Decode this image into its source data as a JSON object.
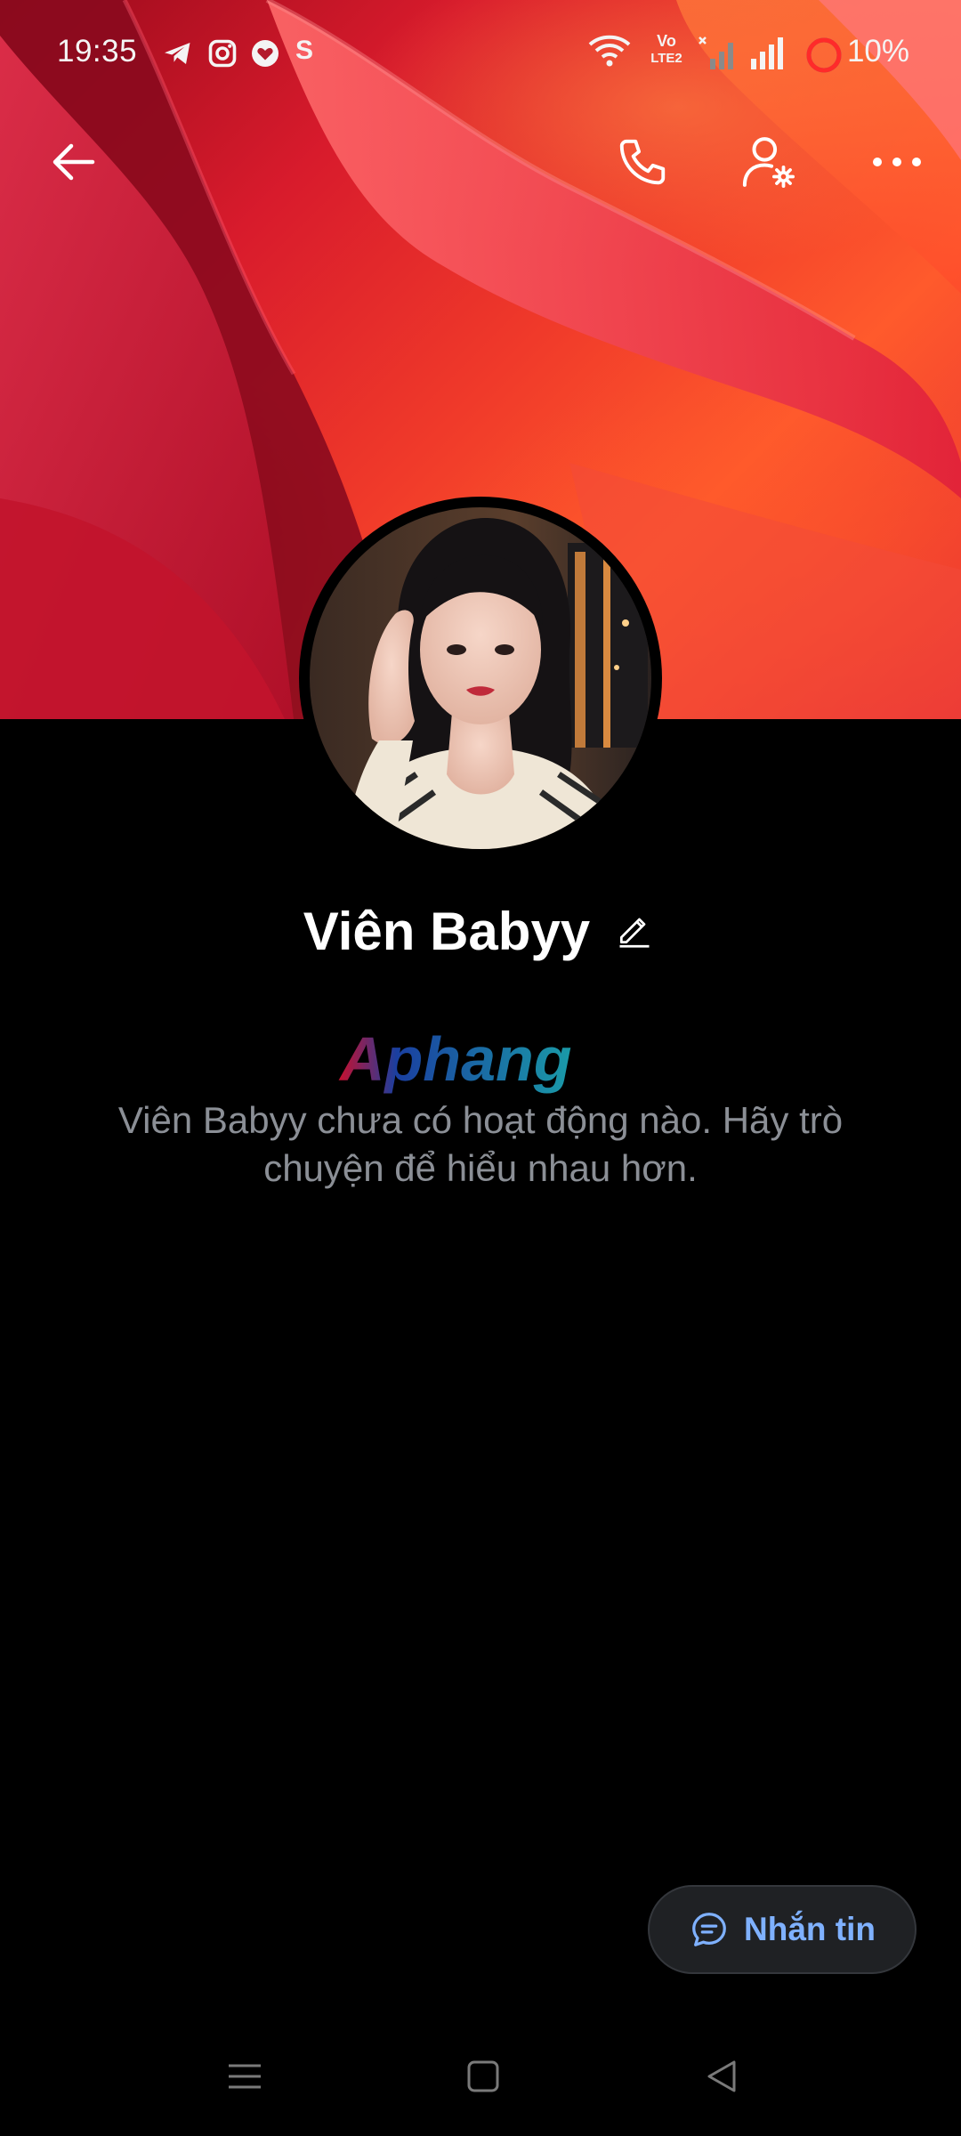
{
  "status_bar": {
    "time": "19:35",
    "notification_icons": [
      "telegram-icon",
      "instagram-icon",
      "heart-app-icon",
      "s-app-icon"
    ],
    "network_label_top": "Vo",
    "network_label_bottom": "LTE2",
    "battery_percent": "10%"
  },
  "top_nav": {
    "icons": [
      "back-arrow-icon",
      "phone-icon",
      "user-settings-icon",
      "more-icon"
    ]
  },
  "profile": {
    "name": "Viên Babyy",
    "empty_state": "Viên Babyy chưa có hoạt động nào. Hãy trò chuyện để hiểu nhau hơn."
  },
  "watermark": {
    "text": "Aphang"
  },
  "message_button": {
    "label": "Nhắn tin"
  },
  "colors": {
    "background": "#000000",
    "muted_text": "#8b8f96",
    "accent": "#7fb1ff",
    "button_bg": "#1f2124"
  }
}
